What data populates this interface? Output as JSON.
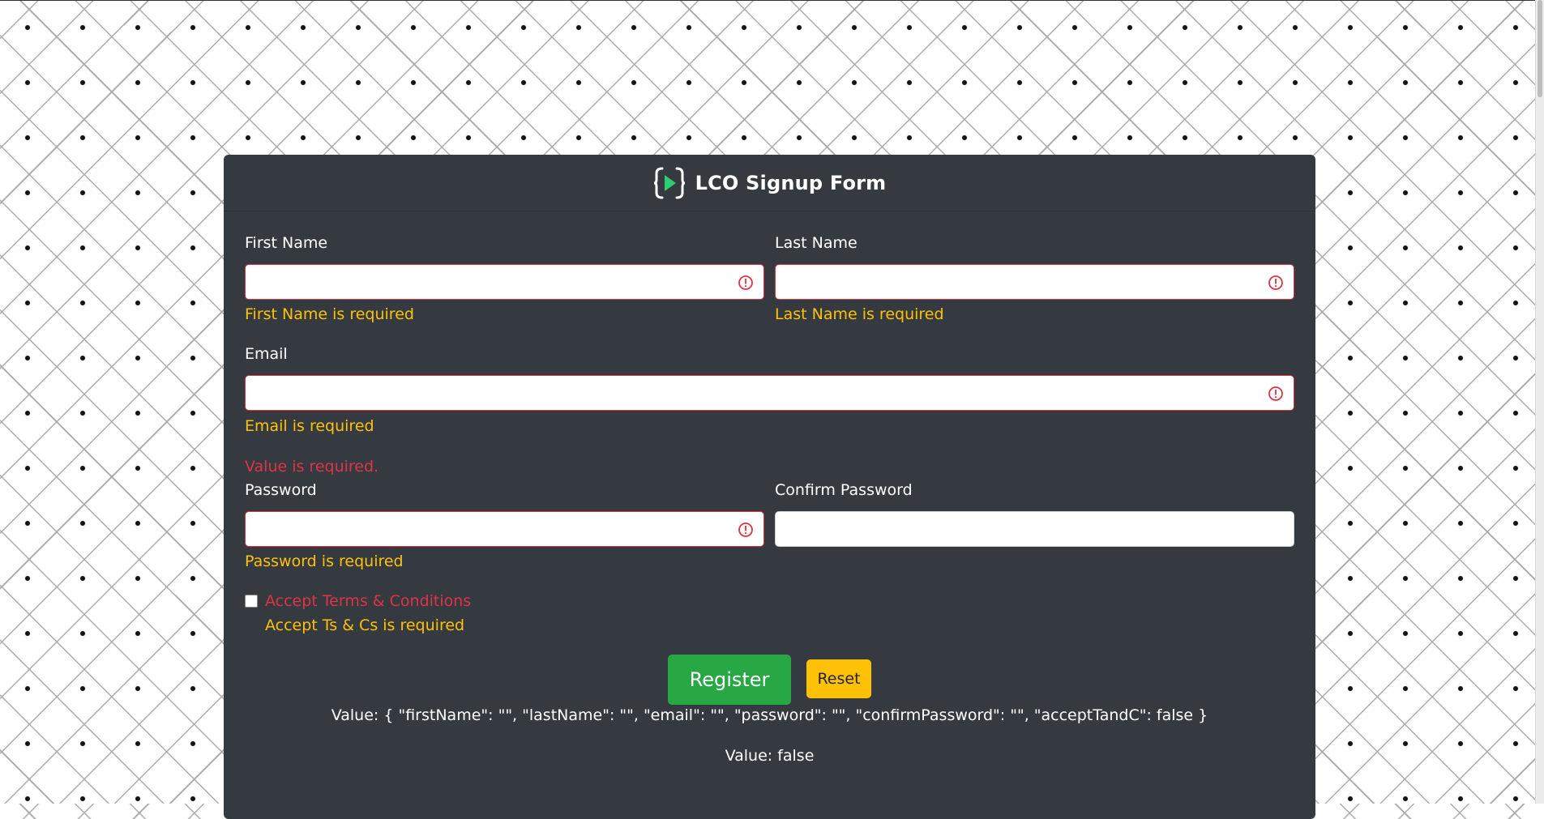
{
  "header": {
    "title": "LCO Signup Form",
    "logo": "play-brackets-logo-icon"
  },
  "form": {
    "first_name": {
      "label": "First Name",
      "value": "",
      "error": "First Name is required"
    },
    "last_name": {
      "label": "Last Name",
      "value": "",
      "error": "Last Name is required"
    },
    "email": {
      "label": "Email",
      "value": "",
      "error": "Email is required"
    },
    "password_group_error": "Value is required.",
    "password": {
      "label": "Password",
      "value": "",
      "error": "Password is required"
    },
    "confirm_password": {
      "label": "Confirm Password",
      "value": ""
    },
    "terms": {
      "label": "Accept Terms & Conditions",
      "checked": false,
      "error": "Accept Ts & Cs is required"
    },
    "register_label": "Register",
    "reset_label": "Reset"
  },
  "debug": {
    "form_value": "Value: { \"firstName\": \"\", \"lastName\": \"\", \"email\": \"\", \"password\": \"\", \"confirmPassword\": \"\", \"acceptTandC\": false }",
    "valid_value": "Value: false"
  },
  "colors": {
    "card_bg": "#343a40",
    "error_border": "#dc3545",
    "feedback_warning": "#ffc107",
    "register_green": "#28a745",
    "reset_yellow": "#ffc107",
    "logo_green": "#2ecc71"
  }
}
